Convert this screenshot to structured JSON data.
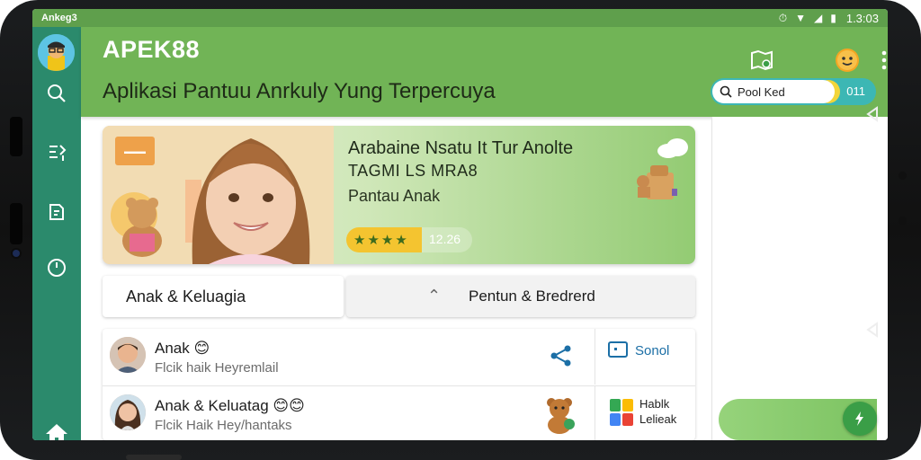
{
  "status_bar": {
    "left_text": "Ankeg3",
    "time": "1.3:03"
  },
  "header": {
    "brand": "APEK88",
    "subtitle": "Aplikasi Pantuu Anrkuly Yung Terpercuya",
    "search": {
      "label": "Pool Ked",
      "count": "011"
    }
  },
  "banner": {
    "tag": "",
    "title": "Arabaine Nsatu It Tur Anolte",
    "title2": "TAGMI LS MRA8",
    "tagline": "Pantau Anak",
    "rating_stars": "★★★★",
    "rating_value": "12.26"
  },
  "tabs": [
    {
      "label": "Anak & Keluagia"
    },
    {
      "label": "Pentun & Bredrerd"
    }
  ],
  "list": [
    {
      "name": "Anak 😊",
      "sub": "Flcik haik Heyremlail",
      "action": "Sonol"
    },
    {
      "name": "Anak & Keluatag 😊😊",
      "sub": "Flcik Haik Hey/hantaks",
      "action_line1": "Hablk",
      "action_line2": "Lelieak"
    }
  ],
  "colors": {
    "rail": "#2b8a6c",
    "header": "#71b456",
    "accent_teal": "#3cb7b4",
    "fab": "#3a9e47"
  }
}
